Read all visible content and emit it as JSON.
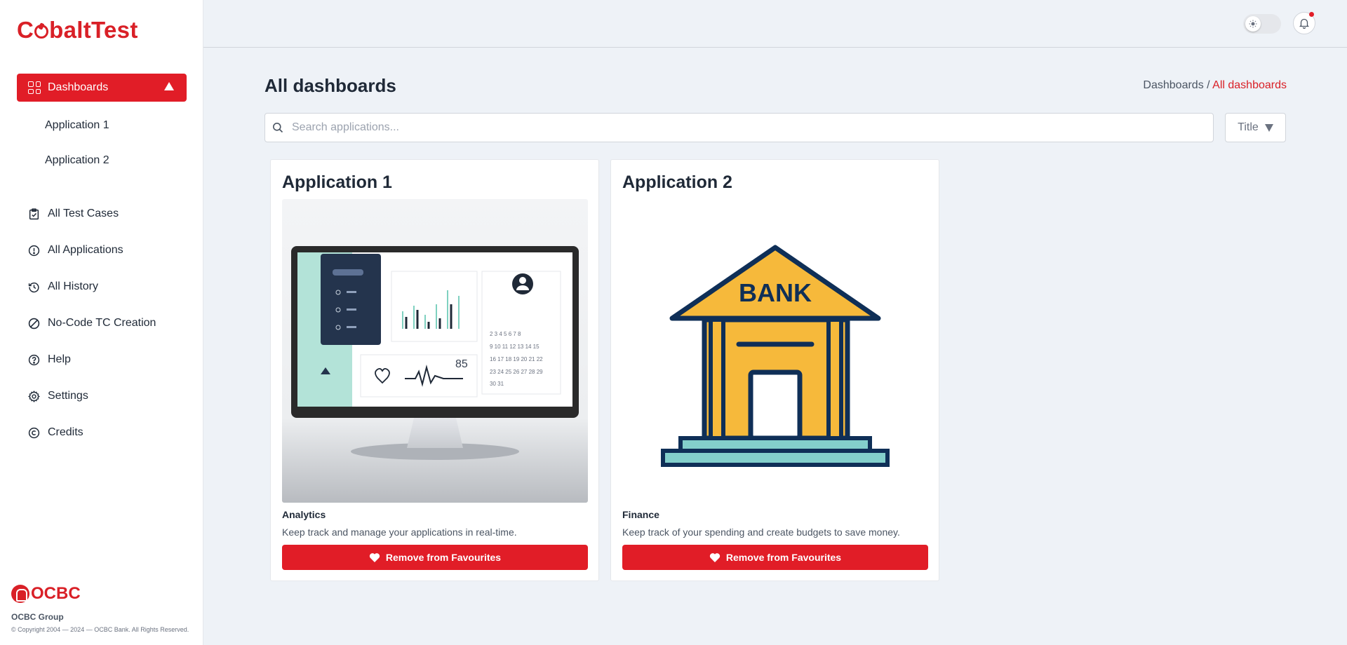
{
  "app": {
    "logo_text_1": "C",
    "logo_text_2": "baltTest"
  },
  "sidebar": {
    "dashboards_label": "Dashboards",
    "sub_items": [
      "Application 1",
      "Application 2"
    ],
    "items": [
      {
        "label": "All Test Cases",
        "icon": "clipboard-check-icon"
      },
      {
        "label": "All Applications",
        "icon": "info-circle-icon"
      },
      {
        "label": "All History",
        "icon": "history-icon"
      },
      {
        "label": "No-Code TC Creation",
        "icon": "ban-icon"
      },
      {
        "label": "Help",
        "icon": "help-circle-icon"
      },
      {
        "label": "Settings",
        "icon": "gear-icon"
      },
      {
        "label": "Credits",
        "icon": "copyright-icon"
      }
    ],
    "footer": {
      "brand": "OCBC",
      "group": "OCBC Group",
      "copyright": "© Copyright 2004 — 2024 — OCBC Bank. All Rights Reserved."
    }
  },
  "header": {
    "theme_toggle": "light",
    "notifications": true
  },
  "main": {
    "title": "All dashboards",
    "breadcrumb": {
      "parent": "Dashboards /",
      "current": "All dashboards"
    },
    "search": {
      "placeholder": "Search applications...",
      "value": ""
    },
    "sort": {
      "label": "Title"
    },
    "cards": [
      {
        "title": "Application 1",
        "category": "Analytics",
        "description": "Keep track and manage your applications in real-time.",
        "button": "Remove from Favourites",
        "image": "monitor-dashboard-image"
      },
      {
        "title": "Application 2",
        "category": "Finance",
        "description": "Keep track of your spending and create budgets to save money.",
        "button": "Remove from Favourites",
        "image": "bank-building-image",
        "image_text": "BANK"
      }
    ]
  },
  "colors": {
    "accent": "#e11d27",
    "background": "#eef2f7"
  }
}
